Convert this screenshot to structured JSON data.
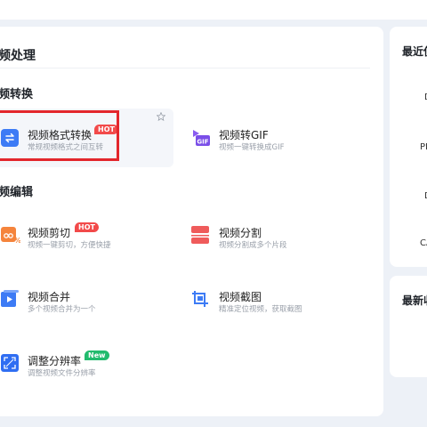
{
  "panel": {
    "title": "频处理"
  },
  "sections": [
    {
      "heading": "频转换"
    },
    {
      "heading": "频编辑"
    }
  ],
  "tools": [
    {
      "title": "视频格式转换",
      "desc": "常规视频格式之间互转",
      "badge": "HOT",
      "icon": "format-convert-icon"
    },
    {
      "title": "视频转GIF",
      "desc": "视频一键转换成GIF",
      "icon": "gif-icon"
    },
    {
      "title": "视频剪切",
      "desc": "视频一键剪切，方便快捷",
      "badge": "HOT",
      "icon": "scissors-icon"
    },
    {
      "title": "视频分割",
      "desc": "视频分割成多个片段",
      "icon": "split-icon"
    },
    {
      "title": "视频合并",
      "desc": "多个视频合并为一个",
      "icon": "merge-icon"
    },
    {
      "title": "视频截图",
      "desc": "精准定位视频，获取截图",
      "icon": "crop-icon"
    },
    {
      "title": "调整分辨率",
      "desc": "调整视频文件分辨率",
      "badge": "New",
      "icon": "resolution-icon"
    }
  ],
  "sidebar": {
    "recent_title": "最近使",
    "recent_items": [
      "D",
      "PD",
      "D",
      "CA"
    ],
    "latest_title": "最新收"
  },
  "colors": {
    "accent_blue": "#3d7bf5",
    "hot_red": "#f24a4a",
    "new_green": "#22bb6e",
    "highlight_red": "#e3262c"
  }
}
